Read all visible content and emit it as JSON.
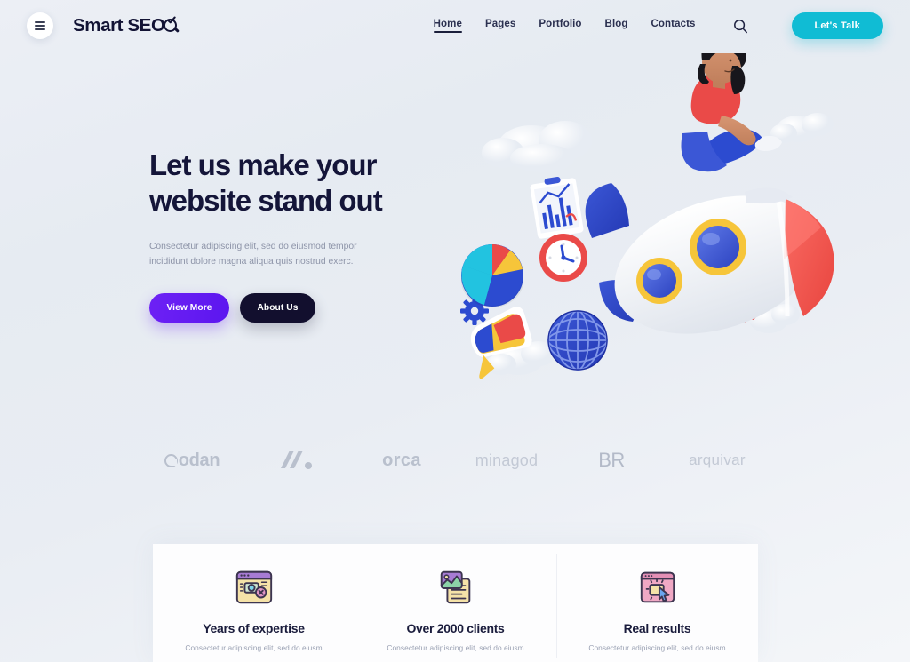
{
  "header": {
    "menu_button": "menu-icon",
    "logo_text": "Smart SEO",
    "nav": [
      {
        "label": "Home",
        "active": true
      },
      {
        "label": "Pages",
        "active": false
      },
      {
        "label": "Portfolio",
        "active": false
      },
      {
        "label": "Blog",
        "active": false
      },
      {
        "label": "Contacts",
        "active": false
      }
    ],
    "search_icon": "search-icon",
    "cta_label": "Let's Talk",
    "cta_color": "#10bcd4"
  },
  "hero": {
    "title_line1": "Let us make your",
    "title_line2": "website stand out",
    "subtitle": "Consectetur adipiscing elit, sed do eiusmod tempor incididunt dolore magna aliqua quis nostrud exerc.",
    "primary_button": "View More",
    "secondary_button": "About Us",
    "primary_color": "#6319f0",
    "secondary_color": "#120f2e",
    "illustration": "woman-riding-rocket-with-clouds-charts-globe-clock-gear"
  },
  "clients": {
    "logos": [
      {
        "name": "Codan",
        "text": "odan"
      },
      {
        "name": "M mark",
        "text": "M."
      },
      {
        "name": "orca",
        "text": "orca"
      },
      {
        "name": "minagod",
        "text": "minagod"
      },
      {
        "name": "BR",
        "text": "BR"
      },
      {
        "name": "arquivar",
        "text": "arquivar"
      }
    ]
  },
  "features": [
    {
      "icon": "browser-settings-icon",
      "title": "Years of expertise",
      "subtitle": "Consectetur adipiscing elit, sed do eiusm"
    },
    {
      "icon": "image-document-icon",
      "title": "Over 2000 clients",
      "subtitle": "Consectetur adipiscing elit, sed do eiusm"
    },
    {
      "icon": "click-cursor-icon",
      "title": "Real results",
      "subtitle": "Consectetur adipiscing elit, sed do eiusm"
    }
  ]
}
